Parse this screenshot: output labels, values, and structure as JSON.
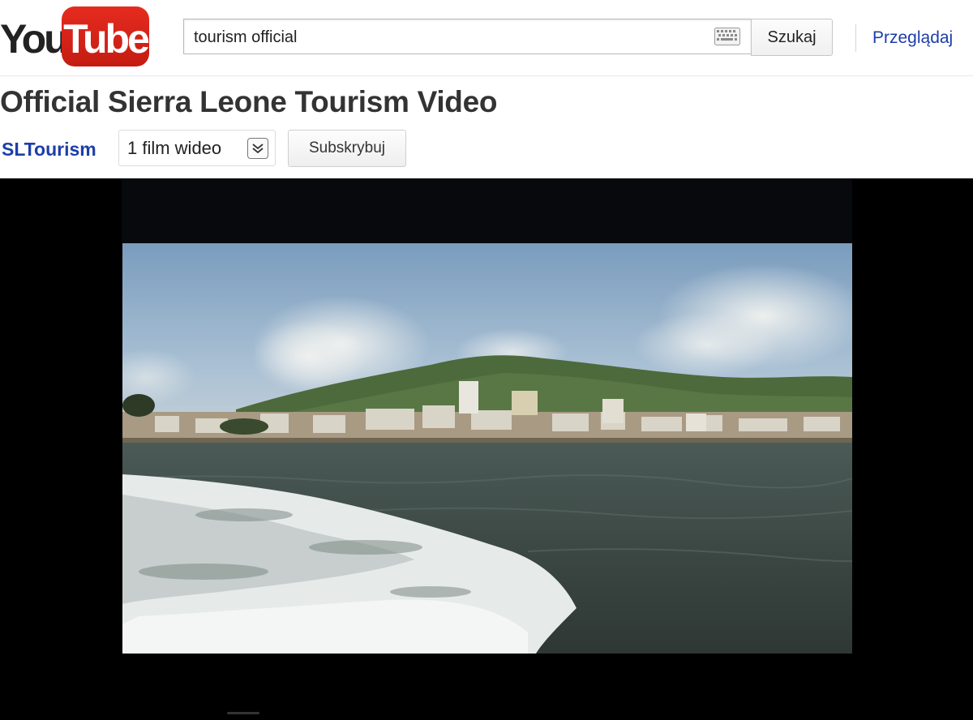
{
  "header": {
    "logo": {
      "you": "You",
      "tube": "Tube"
    },
    "search": {
      "value": "tourism official",
      "button_label": "Szukaj"
    },
    "browse_label": "Przeglądaj"
  },
  "video": {
    "title": "Official Sierra Leone Tourism Video",
    "channel": "SLTourism",
    "video_count_label": "1 film wideo",
    "subscribe_label": "Subskrybuj"
  },
  "colors": {
    "link": "#1c3ea8",
    "logo_red": "#e62b1f",
    "player_bg": "#000000"
  },
  "icons": [
    "keyboard-icon",
    "chevron-down-icon"
  ]
}
